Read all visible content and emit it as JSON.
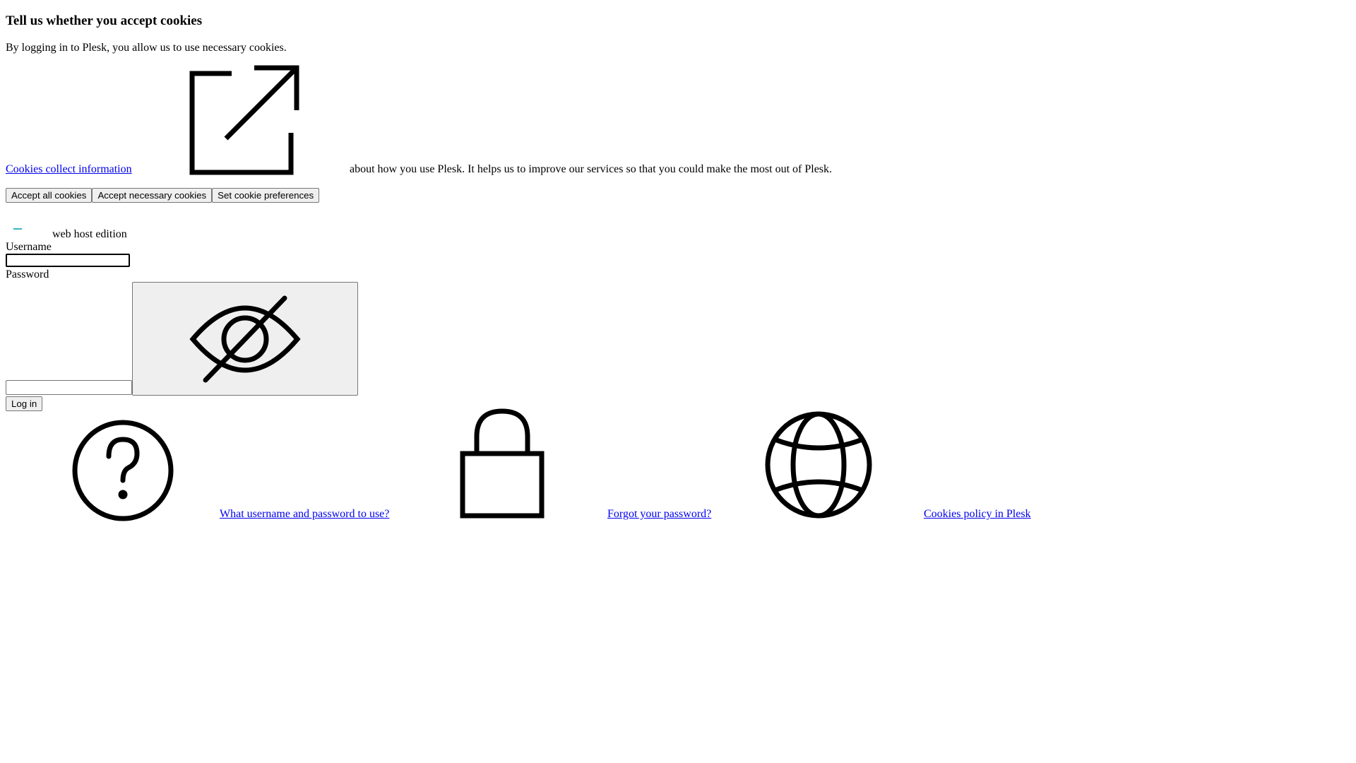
{
  "cookie_banner": {
    "title": "Tell us whether you accept cookies",
    "text": "By logging in to Plesk, you allow us to use necessary cookies.",
    "info_link": "Cookies collect information",
    "info_rest": "about how you use Plesk. It helps us to improve our services so that you could make the most out of Plesk.",
    "buttons": {
      "accept_all": "Accept all cookies",
      "accept_necessary": "Accept necessary cookies",
      "preferences": "Set cookie preferences"
    }
  },
  "login": {
    "edition": "web host edition",
    "username_label": "Username",
    "username_value": "",
    "password_label": "Password",
    "password_value": "",
    "login_button": "Log in"
  },
  "help_links": {
    "credentials": "What username and password to use?",
    "forgot": "Forgot your password?",
    "cookies_policy": "Cookies policy in Plesk"
  },
  "colors": {
    "link": "#0000ee",
    "logo_accent": "#37b5c1"
  },
  "icons": {
    "info_link": "external-link-icon",
    "password_toggle": "eye-slash-icon",
    "credentials": "question-circle-icon",
    "forgot": "lock-icon",
    "cookies_policy": "globe-icon"
  }
}
